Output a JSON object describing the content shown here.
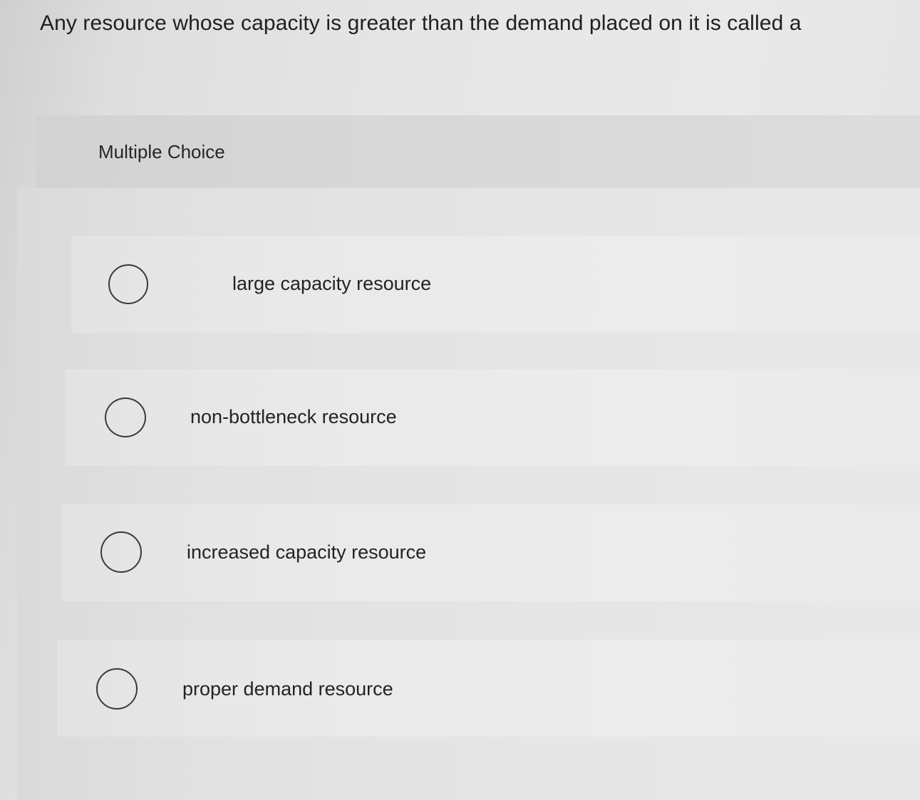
{
  "question": {
    "text": "Any resource whose capacity is greater than the demand placed on it is called a"
  },
  "question_type": {
    "label": "Multiple Choice"
  },
  "options": [
    {
      "label": "large capacity resource",
      "selected": false
    },
    {
      "label": "non-bottleneck resource",
      "selected": false
    },
    {
      "label": "increased capacity resource",
      "selected": false
    },
    {
      "label": "proper demand resource",
      "selected": false
    }
  ],
  "colors": {
    "background": "#e6e6e6",
    "header_band": "#d6d6d6",
    "option_band": "#eaeaea",
    "text": "#202020",
    "radio_border": "#3a3a3a"
  }
}
